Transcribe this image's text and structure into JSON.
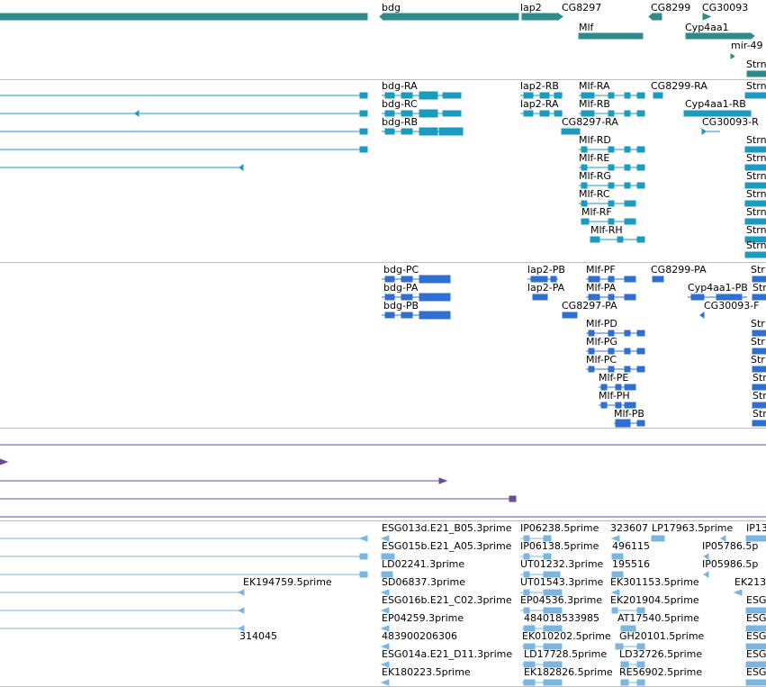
{
  "colors": {
    "gene": "#2e8b8b",
    "transcript": "#1a9bbf",
    "protein": "#2f6fd1",
    "alignment": "#6a4aa0",
    "est": "#7ab6e0",
    "separator": "#bdbdbd"
  },
  "tracks": {
    "genes": {
      "labels": [
        "bdg",
        "lap2",
        "CG8297",
        "CG8299",
        "CG30093",
        "Mlf",
        "Cyp4aa1",
        "mir-49",
        "Strn"
      ]
    },
    "transcripts": {
      "labels": [
        "bdg-RA",
        "lap2-RB",
        "Mlf-RA",
        "CG8299-RA",
        "bdg-RC",
        "lap2-RA",
        "Mlf-RB",
        "Cyp4aa1-RB",
        "bdg-RB",
        "CG8297-RA",
        "CG30093-R",
        "Strn",
        "Mlf-RD",
        "Strn",
        "Mlf-RE",
        "Strn",
        "Mlf-RG",
        "Strn",
        "Mlf-RC",
        "Strn",
        "Mlf-RF",
        "Strn",
        "Mlf-RH",
        "Strn",
        "Strn"
      ]
    },
    "proteins": {
      "labels": [
        "bdg-PC",
        "lap2-PB",
        "Mlf-PF",
        "CG8299-PA",
        "Str",
        "bdg-PA",
        "lap2-PA",
        "Mlf-PA",
        "Cyp4aa1-PB",
        "Str",
        "bdg-PB",
        "CG8297-PA",
        "CG30093-F",
        "Mlf-PD",
        "Str",
        "Mlf-PG",
        "Str",
        "Mlf-PC",
        "Str",
        "Mlf-PE",
        "Str",
        "Mlf-PH",
        "Str",
        "Mlf-PB",
        "Str"
      ]
    },
    "ests": {
      "labels": [
        "ESG013d.E21_B05.3prime",
        "IP06238.5prime",
        "323607",
        "LP17963.5prime",
        "IP13",
        "ESG015b.E21_A05.3prime",
        "IP06138.5prime",
        "496115",
        "IP05786.5p",
        "LD02241.3prime",
        "UT01232.3prime",
        "195516",
        "IP05986.5p",
        "EK194759.5prime",
        "SD06837.3prime",
        "UT01543.3prime",
        "EK301153.5prime",
        "EK213",
        "ESG016b.E21_C02.3prime",
        "EP04536.3prime",
        "EK201904.5prime",
        "ESG",
        "EP04259.3prime",
        "484018533985",
        "AT17540.5prime",
        "ESG",
        "314045",
        "483900206306",
        "EK010202.5prime",
        "GH20101.5prime",
        "ESG",
        "ESG014a.E21_D11.3prime",
        "LD17728.5prime",
        "LD32726.5prime",
        "ESG",
        "EK180223.5prime",
        "EK182826.5prime",
        "RE56902.5prime",
        "ESG"
      ]
    }
  }
}
